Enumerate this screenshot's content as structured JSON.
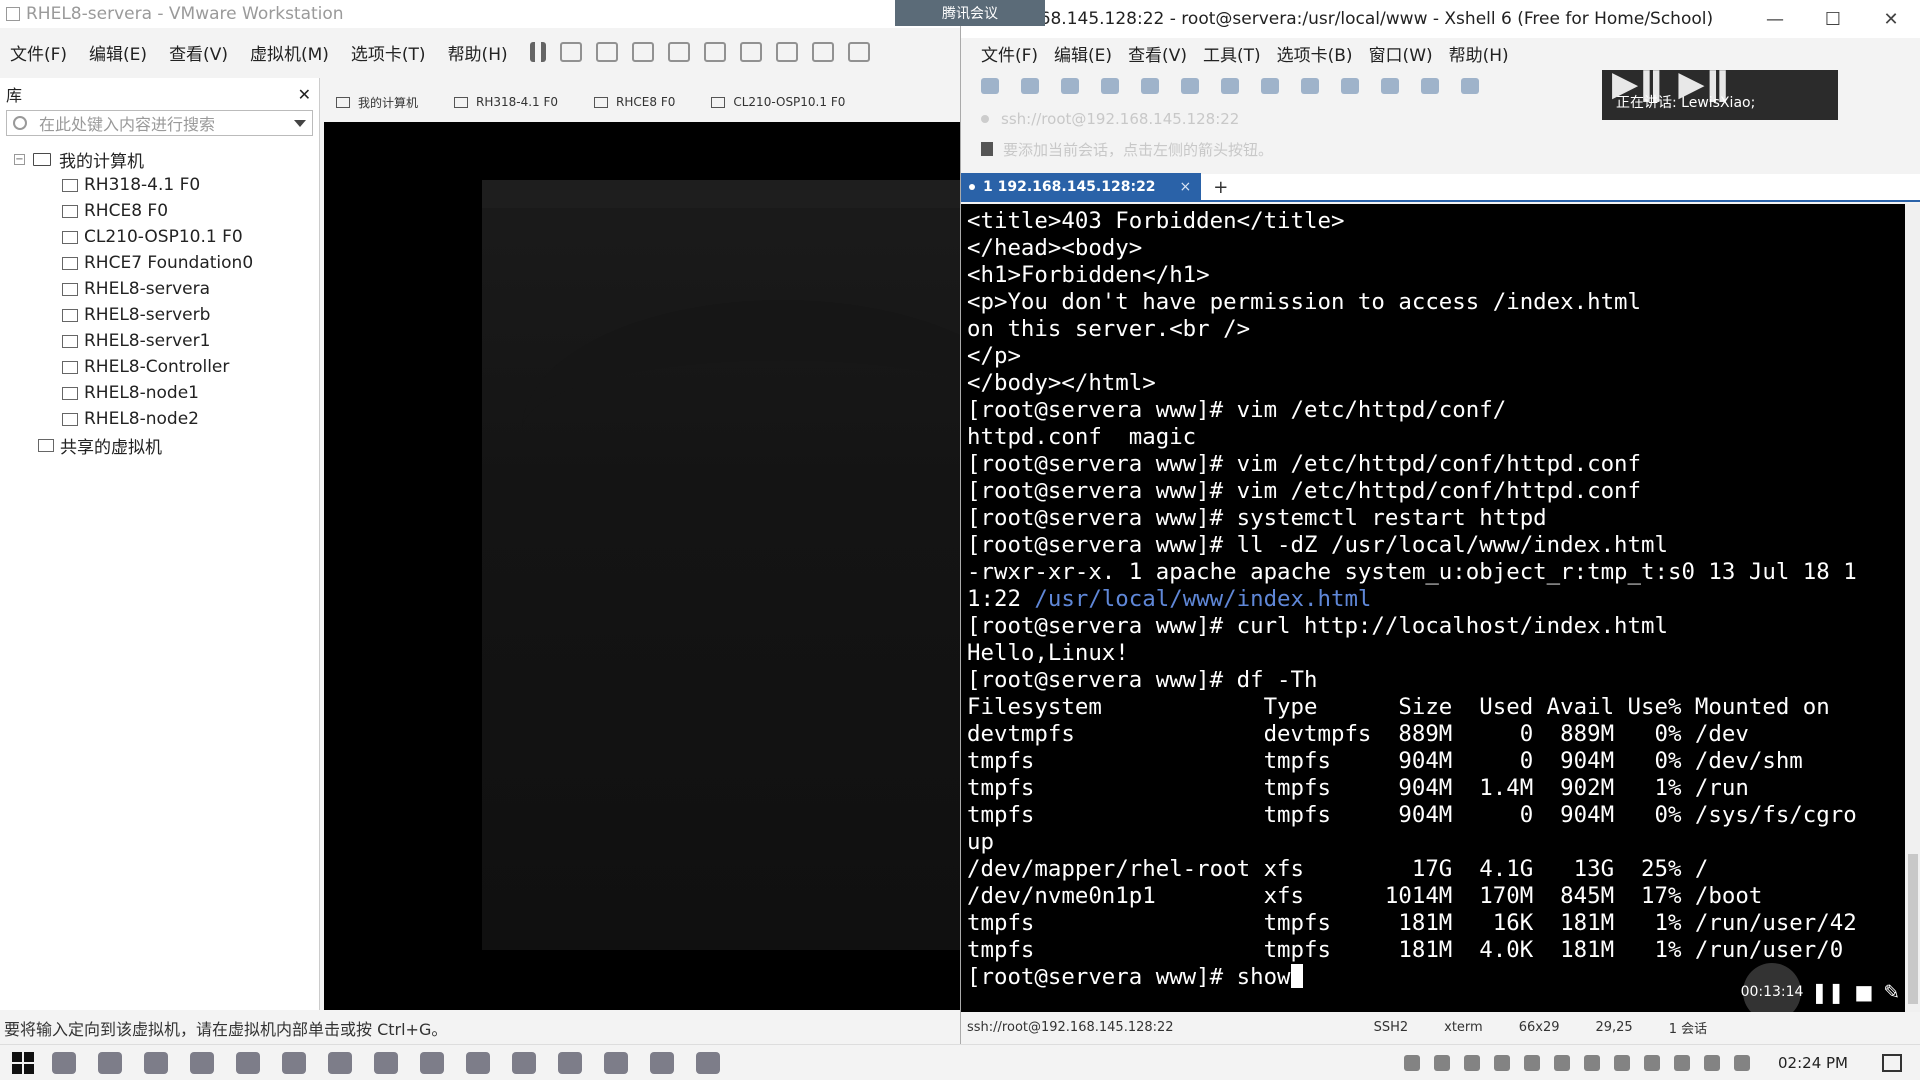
{
  "vmware": {
    "title": "RHEL8-servera - VMware Workstation",
    "menu": [
      "文件(F)",
      "编辑(E)",
      "查看(V)",
      "虚拟机(M)",
      "选项卡(T)",
      "帮助(H)"
    ],
    "library": {
      "header": "库",
      "search_placeholder": "在此处键入内容进行搜索",
      "root": "我的计算机",
      "vms": [
        "RH318-4.1 F0",
        "RHCE8 F0",
        "CL210-OSP10.1 F0",
        "RHCE7 Foundation0",
        "RHEL8-servera",
        "RHEL8-serverb",
        "RHEL8-server1",
        "RHEL8-Controller",
        "RHEL8-node1",
        "RHEL8-node2"
      ],
      "shared": "共享的虚拟机"
    },
    "tabs": [
      "我的计算机",
      "RH318-4.1 F0",
      "RHCE8 F0",
      "CL210-OSP10.1 F0"
    ],
    "status_text": "要将输入定向到该虚拟机，请在虚拟机内部单击或按 Ctrl+G。"
  },
  "xshell": {
    "title": "192.168.145.128:22 - root@servera:/usr/local/www - Xshell 6 (Free for Home/School)",
    "menu": [
      "文件(F)",
      "编辑(E)",
      "查看(V)",
      "工具(T)",
      "选项卡(B)",
      "窗口(W)",
      "帮助(H)"
    ],
    "address": "ssh://root@192.168.145.128:22",
    "hint": "要添加当前会话，点击左侧的箭头按钮。",
    "tencent_label": "腾讯会议",
    "meeting_speaking": "正在讲话: LewisXiao;",
    "session_tab": "1 192.168.145.128:22",
    "terminal_lines": [
      "<title>403 Forbidden</title>",
      "</head><body>",
      "<h1>Forbidden</h1>",
      "<p>You don't have permission to access /index.html",
      "on this server.<br />",
      "</p>",
      "</body></html>",
      "[root@servera www]# vim /etc/httpd/conf/",
      "httpd.conf  magic",
      "[root@servera www]# vim /etc/httpd/conf/httpd.conf",
      "[root@servera www]# vim /etc/httpd/conf/httpd.conf",
      "[root@servera www]# systemctl restart httpd",
      "[root@servera www]# ll -dZ /usr/local/www/index.html",
      "-rwxr-xr-x. 1 apache apache system_u:object_r:tmp_t:s0 13 Jul 18 1",
      "1:22 ",
      "[root@servera www]# curl http://localhost/index.html",
      "Hello,Linux!",
      "[root@servera www]# df -Th",
      "Filesystem            Type      Size  Used Avail Use% Mounted on",
      "devtmpfs              devtmpfs  889M     0  889M   0% /dev",
      "tmpfs                 tmpfs     904M     0  904M   0% /dev/shm",
      "tmpfs                 tmpfs     904M  1.4M  902M   1% /run",
      "tmpfs                 tmpfs     904M     0  904M   0% /sys/fs/cgro",
      "up",
      "/dev/mapper/rhel-root xfs        17G  4.1G   13G  25% /",
      "/dev/nvme0n1p1        xfs      1014M  170M  845M  17% /boot",
      "tmpfs                 tmpfs     181M   16K  181M   1% /run/user/42",
      "tmpfs                 tmpfs     181M  4.0K  181M   1% /run/user/0",
      "[root@servera www]# show"
    ],
    "highlight_path": "/usr/local/www/index.html",
    "recording_time": "00:13:14",
    "status": {
      "connection": "ssh://root@192.168.145.128:22",
      "protocol": "SSH2",
      "terminal": "xterm",
      "size": "66x29",
      "cursor": "29,25",
      "sessions": "1 会话"
    }
  },
  "taskbar": {
    "clock": "02:24 PM"
  }
}
